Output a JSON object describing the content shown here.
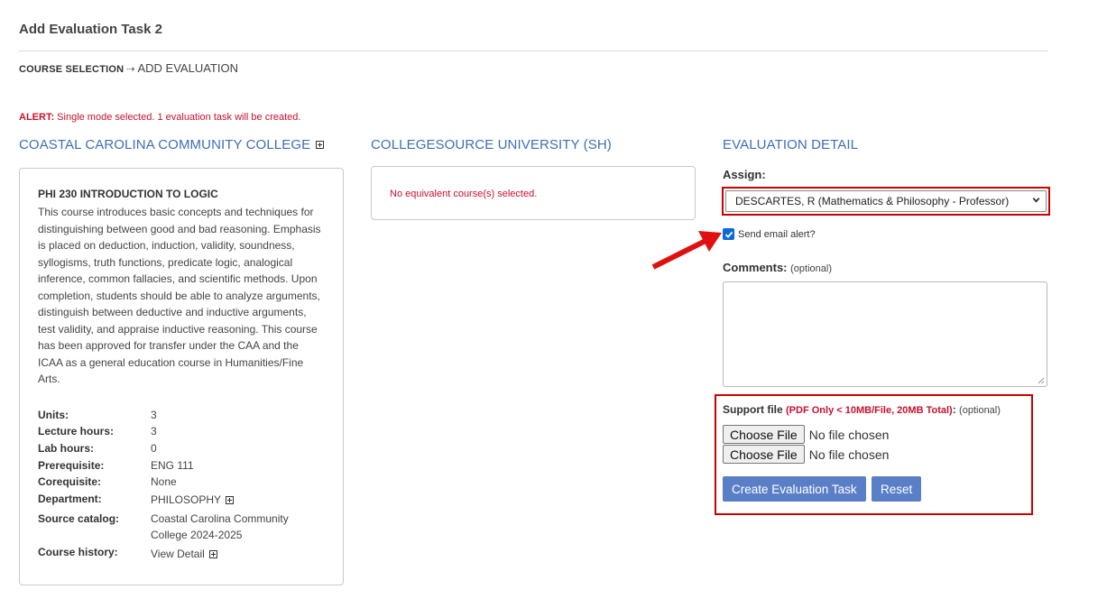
{
  "page": {
    "title": "Add Evaluation Task 2"
  },
  "breadcrumb": {
    "step1": "COURSE SELECTION",
    "separator": "⇢",
    "step2": "ADD EVALUATION"
  },
  "alert": {
    "prefix": "ALERT:",
    "message": "Single mode selected. 1 evaluation task will be created."
  },
  "source_college": {
    "heading": "COASTAL CAROLINA COMMUNITY COLLEGE",
    "course_code": "PHI 230 INTRODUCTION TO LOGIC",
    "description": "This course introduces basic concepts and techniques for distinguishing between good and bad reasoning. Emphasis is placed on deduction, induction, validity, soundness, syllogisms, truth functions, predicate logic, analogical inference, common fallacies, and scientific methods. Upon completion, students should be able to analyze arguments, distinguish between deductive and inductive arguments, test validity, and appraise inductive reasoning. This course has been approved for transfer under the CAA and the ICAA as a general education course in Humanities/Fine Arts.",
    "details": {
      "units_label": "Units:",
      "units": "3",
      "lecture_label": "Lecture hours:",
      "lecture": "3",
      "lab_label": "Lab hours:",
      "lab": "0",
      "prereq_label": "Prerequisite:",
      "prereq": "ENG 111",
      "coreq_label": "Corequisite:",
      "coreq": "None",
      "department_label": "Department:",
      "department": "PHILOSOPHY",
      "catalog_label": "Source catalog:",
      "catalog": "Coastal Carolina Community College 2024-2025",
      "history_label": "Course history:",
      "history": "View Detail"
    }
  },
  "target_university": {
    "heading": "COLLEGESOURCE UNIVERSITY (SH)",
    "empty_message": "No equivalent course(s) selected."
  },
  "evaluation": {
    "heading": "EVALUATION DETAIL",
    "assign_label": "Assign:",
    "assign_value": "DESCARTES, R (Mathematics & Philosophy - Professor)",
    "email_alert_label": "Send email alert?",
    "email_alert_checked": true,
    "comments_label": "Comments:",
    "comments_optional": "(optional)",
    "support_label": "Support file",
    "support_hint": "(PDF Only < 10MB/File, 20MB Total)",
    "support_colon": ":",
    "support_optional": "(optional)",
    "file_inputs": [
      {
        "button": "Choose File",
        "status": "No file chosen"
      },
      {
        "button": "Choose File",
        "status": "No file chosen"
      }
    ],
    "create_button": "Create Evaluation Task",
    "reset_button": "Reset"
  },
  "colors": {
    "accent_blue": "#3d6fb3",
    "button_blue": "#5b7fc7",
    "alert_red": "#c8102e",
    "highlight_red": "#cc0000"
  }
}
